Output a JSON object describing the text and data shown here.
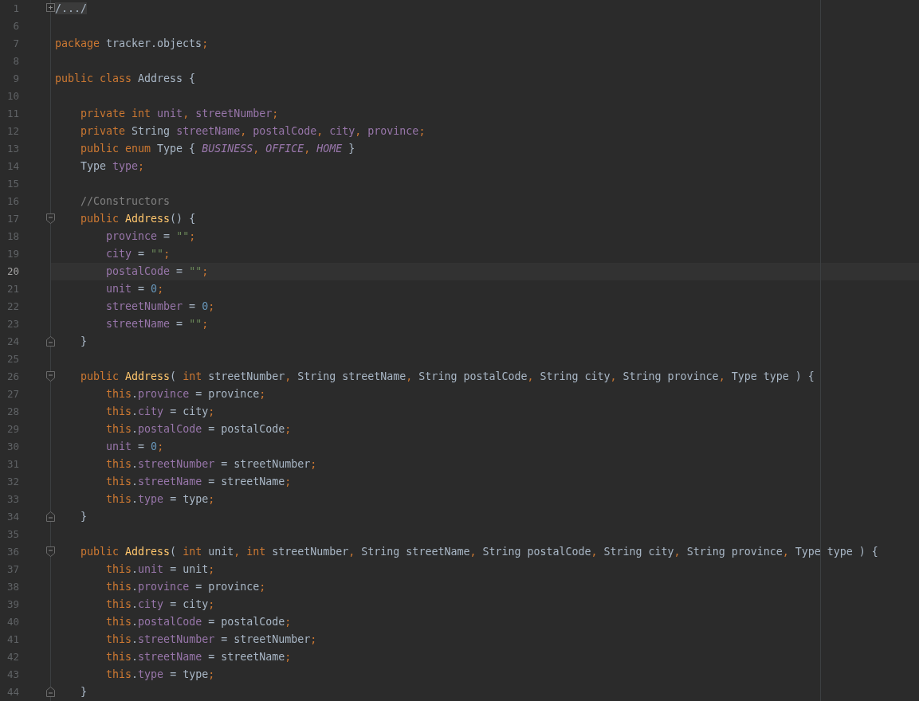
{
  "lines": [
    {
      "number": "1",
      "current": false,
      "marker": {
        "kind": "plus"
      },
      "tokens": [
        {
          "text": "/.../",
          "kind": "folded"
        }
      ]
    },
    {
      "number": "6",
      "current": false
    },
    {
      "number": "7",
      "current": false,
      "tokens": [
        {
          "text": "package ",
          "kind": "keyword"
        },
        {
          "text": "tracker.objects",
          "kind": "plain"
        },
        {
          "text": ";",
          "kind": "keyword"
        }
      ]
    },
    {
      "number": "8",
      "current": false
    },
    {
      "number": "9",
      "current": false,
      "tokens": [
        {
          "text": "public class ",
          "kind": "keyword"
        },
        {
          "text": "Address {",
          "kind": "plain"
        }
      ]
    },
    {
      "number": "10",
      "current": false
    },
    {
      "number": "11",
      "current": false,
      "tokens": [
        {
          "text": "    private int ",
          "kind": "keyword"
        },
        {
          "text": "unit",
          "kind": "field"
        },
        {
          "text": ", ",
          "kind": "keyword"
        },
        {
          "text": "streetNumber",
          "kind": "field"
        },
        {
          "text": ";",
          "kind": "keyword"
        }
      ]
    },
    {
      "number": "12",
      "current": false,
      "tokens": [
        {
          "text": "    private ",
          "kind": "keyword"
        },
        {
          "text": "String ",
          "kind": "plain"
        },
        {
          "text": "streetName",
          "kind": "field"
        },
        {
          "text": ", ",
          "kind": "keyword"
        },
        {
          "text": "postalCode",
          "kind": "field"
        },
        {
          "text": ", ",
          "kind": "keyword"
        },
        {
          "text": "city",
          "kind": "field"
        },
        {
          "text": ", ",
          "kind": "keyword"
        },
        {
          "text": "province",
          "kind": "field"
        },
        {
          "text": ";",
          "kind": "keyword"
        }
      ]
    },
    {
      "number": "13",
      "current": false,
      "tokens": [
        {
          "text": "    public enum ",
          "kind": "keyword"
        },
        {
          "text": "Type { ",
          "kind": "plain"
        },
        {
          "text": "BUSINESS",
          "kind": "constant"
        },
        {
          "text": ", ",
          "kind": "keyword"
        },
        {
          "text": "OFFICE",
          "kind": "constant"
        },
        {
          "text": ", ",
          "kind": "keyword"
        },
        {
          "text": "HOME",
          "kind": "constant"
        },
        {
          "text": " }",
          "kind": "plain"
        }
      ]
    },
    {
      "number": "14",
      "current": false,
      "tokens": [
        {
          "text": "    Type ",
          "kind": "plain"
        },
        {
          "text": "type",
          "kind": "field"
        },
        {
          "text": ";",
          "kind": "keyword"
        }
      ]
    },
    {
      "number": "15",
      "current": false
    },
    {
      "number": "16",
      "current": false,
      "tokens": [
        {
          "text": "    //Constructors",
          "kind": "comment"
        }
      ]
    },
    {
      "number": "17",
      "current": false,
      "marker": {
        "kind": "open"
      },
      "tokens": [
        {
          "text": "    public ",
          "kind": "keyword"
        },
        {
          "text": "Address",
          "kind": "method"
        },
        {
          "text": "() {",
          "kind": "plain"
        }
      ]
    },
    {
      "number": "18",
      "current": false,
      "tokens": [
        {
          "text": "        province",
          "kind": "field"
        },
        {
          "text": " = ",
          "kind": "plain"
        },
        {
          "text": "\"\"",
          "kind": "string"
        },
        {
          "text": ";",
          "kind": "keyword"
        }
      ]
    },
    {
      "number": "19",
      "current": false,
      "tokens": [
        {
          "text": "        city",
          "kind": "field"
        },
        {
          "text": " = ",
          "kind": "plain"
        },
        {
          "text": "\"\"",
          "kind": "string"
        },
        {
          "text": ";",
          "kind": "keyword"
        }
      ]
    },
    {
      "number": "20",
      "current": true,
      "tokens": [
        {
          "text": "        postalCode",
          "kind": "field"
        },
        {
          "text": " = ",
          "kind": "plain"
        },
        {
          "text": "\"\"",
          "kind": "string"
        },
        {
          "text": ";",
          "kind": "keyword"
        }
      ]
    },
    {
      "number": "21",
      "current": false,
      "tokens": [
        {
          "text": "        unit",
          "kind": "field"
        },
        {
          "text": " = ",
          "kind": "plain"
        },
        {
          "text": "0",
          "kind": "number"
        },
        {
          "text": ";",
          "kind": "keyword"
        }
      ]
    },
    {
      "number": "22",
      "current": false,
      "tokens": [
        {
          "text": "        streetNumber",
          "kind": "field"
        },
        {
          "text": " = ",
          "kind": "plain"
        },
        {
          "text": "0",
          "kind": "number"
        },
        {
          "text": ";",
          "kind": "keyword"
        }
      ]
    },
    {
      "number": "23",
      "current": false,
      "tokens": [
        {
          "text": "        streetName",
          "kind": "field"
        },
        {
          "text": " = ",
          "kind": "plain"
        },
        {
          "text": "\"\"",
          "kind": "string"
        },
        {
          "text": ";",
          "kind": "keyword"
        }
      ]
    },
    {
      "number": "24",
      "current": false,
      "marker": {
        "kind": "close"
      },
      "tokens": [
        {
          "text": "    }",
          "kind": "plain"
        }
      ]
    },
    {
      "number": "25",
      "current": false
    },
    {
      "number": "26",
      "current": false,
      "marker": {
        "kind": "open"
      },
      "tokens": [
        {
          "text": "    public ",
          "kind": "keyword"
        },
        {
          "text": "Address",
          "kind": "method"
        },
        {
          "text": "( ",
          "kind": "plain"
        },
        {
          "text": "int ",
          "kind": "keyword"
        },
        {
          "text": "streetNumber",
          "kind": "plain"
        },
        {
          "text": ", ",
          "kind": "keyword"
        },
        {
          "text": "String streetName",
          "kind": "plain"
        },
        {
          "text": ", ",
          "kind": "keyword"
        },
        {
          "text": "String postalCode",
          "kind": "plain"
        },
        {
          "text": ", ",
          "kind": "keyword"
        },
        {
          "text": "String city",
          "kind": "plain"
        },
        {
          "text": ", ",
          "kind": "keyword"
        },
        {
          "text": "String province",
          "kind": "plain"
        },
        {
          "text": ", ",
          "kind": "keyword"
        },
        {
          "text": "Type type ) {",
          "kind": "plain"
        }
      ]
    },
    {
      "number": "27",
      "current": false,
      "tokens": [
        {
          "text": "        this",
          "kind": "keyword"
        },
        {
          "text": ".",
          "kind": "plain"
        },
        {
          "text": "province",
          "kind": "field"
        },
        {
          "text": " = province",
          "kind": "plain"
        },
        {
          "text": ";",
          "kind": "keyword"
        }
      ]
    },
    {
      "number": "28",
      "current": false,
      "tokens": [
        {
          "text": "        this",
          "kind": "keyword"
        },
        {
          "text": ".",
          "kind": "plain"
        },
        {
          "text": "city",
          "kind": "field"
        },
        {
          "text": " = city",
          "kind": "plain"
        },
        {
          "text": ";",
          "kind": "keyword"
        }
      ]
    },
    {
      "number": "29",
      "current": false,
      "tokens": [
        {
          "text": "        this",
          "kind": "keyword"
        },
        {
          "text": ".",
          "kind": "plain"
        },
        {
          "text": "postalCode",
          "kind": "field"
        },
        {
          "text": " = postalCode",
          "kind": "plain"
        },
        {
          "text": ";",
          "kind": "keyword"
        }
      ]
    },
    {
      "number": "30",
      "current": false,
      "tokens": [
        {
          "text": "        unit",
          "kind": "field"
        },
        {
          "text": " = ",
          "kind": "plain"
        },
        {
          "text": "0",
          "kind": "number"
        },
        {
          "text": ";",
          "kind": "keyword"
        }
      ]
    },
    {
      "number": "31",
      "current": false,
      "tokens": [
        {
          "text": "        this",
          "kind": "keyword"
        },
        {
          "text": ".",
          "kind": "plain"
        },
        {
          "text": "streetNumber",
          "kind": "field"
        },
        {
          "text": " = streetNumber",
          "kind": "plain"
        },
        {
          "text": ";",
          "kind": "keyword"
        }
      ]
    },
    {
      "number": "32",
      "current": false,
      "tokens": [
        {
          "text": "        this",
          "kind": "keyword"
        },
        {
          "text": ".",
          "kind": "plain"
        },
        {
          "text": "streetName",
          "kind": "field"
        },
        {
          "text": " = streetName",
          "kind": "plain"
        },
        {
          "text": ";",
          "kind": "keyword"
        }
      ]
    },
    {
      "number": "33",
      "current": false,
      "tokens": [
        {
          "text": "        this",
          "kind": "keyword"
        },
        {
          "text": ".",
          "kind": "plain"
        },
        {
          "text": "type",
          "kind": "field"
        },
        {
          "text": " = type",
          "kind": "plain"
        },
        {
          "text": ";",
          "kind": "keyword"
        }
      ]
    },
    {
      "number": "34",
      "current": false,
      "marker": {
        "kind": "close"
      },
      "tokens": [
        {
          "text": "    }",
          "kind": "plain"
        }
      ]
    },
    {
      "number": "35",
      "current": false
    },
    {
      "number": "36",
      "current": false,
      "marker": {
        "kind": "open"
      },
      "tokens": [
        {
          "text": "    public ",
          "kind": "keyword"
        },
        {
          "text": "Address",
          "kind": "method"
        },
        {
          "text": "( ",
          "kind": "plain"
        },
        {
          "text": "int ",
          "kind": "keyword"
        },
        {
          "text": "unit",
          "kind": "plain"
        },
        {
          "text": ", ",
          "kind": "keyword"
        },
        {
          "text": "int ",
          "kind": "keyword"
        },
        {
          "text": "streetNumber",
          "kind": "plain"
        },
        {
          "text": ", ",
          "kind": "keyword"
        },
        {
          "text": "String streetName",
          "kind": "plain"
        },
        {
          "text": ", ",
          "kind": "keyword"
        },
        {
          "text": "String postalCode",
          "kind": "plain"
        },
        {
          "text": ", ",
          "kind": "keyword"
        },
        {
          "text": "String city",
          "kind": "plain"
        },
        {
          "text": ", ",
          "kind": "keyword"
        },
        {
          "text": "String province",
          "kind": "plain"
        },
        {
          "text": ", ",
          "kind": "keyword"
        },
        {
          "text": "Type type ) {",
          "kind": "plain"
        }
      ]
    },
    {
      "number": "37",
      "current": false,
      "tokens": [
        {
          "text": "        this",
          "kind": "keyword"
        },
        {
          "text": ".",
          "kind": "plain"
        },
        {
          "text": "unit",
          "kind": "field"
        },
        {
          "text": " = unit",
          "kind": "plain"
        },
        {
          "text": ";",
          "kind": "keyword"
        }
      ]
    },
    {
      "number": "38",
      "current": false,
      "tokens": [
        {
          "text": "        this",
          "kind": "keyword"
        },
        {
          "text": ".",
          "kind": "plain"
        },
        {
          "text": "province",
          "kind": "field"
        },
        {
          "text": " = province",
          "kind": "plain"
        },
        {
          "text": ";",
          "kind": "keyword"
        }
      ]
    },
    {
      "number": "39",
      "current": false,
      "tokens": [
        {
          "text": "        this",
          "kind": "keyword"
        },
        {
          "text": ".",
          "kind": "plain"
        },
        {
          "text": "city",
          "kind": "field"
        },
        {
          "text": " = city",
          "kind": "plain"
        },
        {
          "text": ";",
          "kind": "keyword"
        }
      ]
    },
    {
      "number": "40",
      "current": false,
      "tokens": [
        {
          "text": "        this",
          "kind": "keyword"
        },
        {
          "text": ".",
          "kind": "plain"
        },
        {
          "text": "postalCode",
          "kind": "field"
        },
        {
          "text": " = postalCode",
          "kind": "plain"
        },
        {
          "text": ";",
          "kind": "keyword"
        }
      ]
    },
    {
      "number": "41",
      "current": false,
      "tokens": [
        {
          "text": "        this",
          "kind": "keyword"
        },
        {
          "text": ".",
          "kind": "plain"
        },
        {
          "text": "streetNumber",
          "kind": "field"
        },
        {
          "text": " = streetNumber",
          "kind": "plain"
        },
        {
          "text": ";",
          "kind": "keyword"
        }
      ]
    },
    {
      "number": "42",
      "current": false,
      "tokens": [
        {
          "text": "        this",
          "kind": "keyword"
        },
        {
          "text": ".",
          "kind": "plain"
        },
        {
          "text": "streetName",
          "kind": "field"
        },
        {
          "text": " = streetName",
          "kind": "plain"
        },
        {
          "text": ";",
          "kind": "keyword"
        }
      ]
    },
    {
      "number": "43",
      "current": false,
      "tokens": [
        {
          "text": "        this",
          "kind": "keyword"
        },
        {
          "text": ".",
          "kind": "plain"
        },
        {
          "text": "type",
          "kind": "field"
        },
        {
          "text": " = type",
          "kind": "plain"
        },
        {
          "text": ";",
          "kind": "keyword"
        }
      ]
    },
    {
      "number": "44",
      "current": false,
      "marker": {
        "kind": "close"
      },
      "tokens": [
        {
          "text": "    }",
          "kind": "plain"
        }
      ]
    }
  ]
}
